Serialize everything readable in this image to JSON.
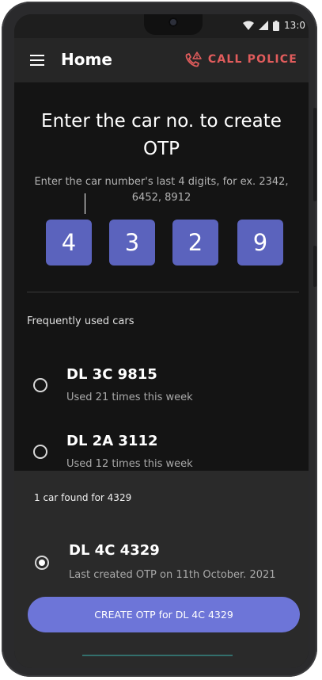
{
  "status_bar": {
    "time": "13:0"
  },
  "app_bar": {
    "title": "Home",
    "call_police_label": "CALL POLICE"
  },
  "main": {
    "heading": "Enter the car no. to create OTP",
    "subheading": "Enter the car number's last 4 digits, for ex. 2342, 6452, 8912",
    "otp_digits": [
      "4",
      "3",
      "2",
      "9"
    ],
    "frequent_label": "Frequently used cars",
    "frequent_cars": [
      {
        "number": "DL 3C 9815",
        "usage": "Used 21 times this week"
      },
      {
        "number": "DL 2A 3112",
        "usage": "Used 12 times this week"
      }
    ]
  },
  "result_sheet": {
    "found_label": "1 car found for 4329",
    "car": {
      "number": "DL 4C 4329",
      "detail": "Last created OTP on 11th October. 2021",
      "selected": true
    },
    "cta_label": "CREATE OTP for DL 4C 4329"
  },
  "colors": {
    "accent": "#5b63bd",
    "cta": "#6d75d8",
    "police": "#e15c5c"
  },
  "icons": [
    "menu-icon",
    "phone-alert-icon",
    "wifi-icon",
    "signal-icon",
    "battery-icon"
  ]
}
